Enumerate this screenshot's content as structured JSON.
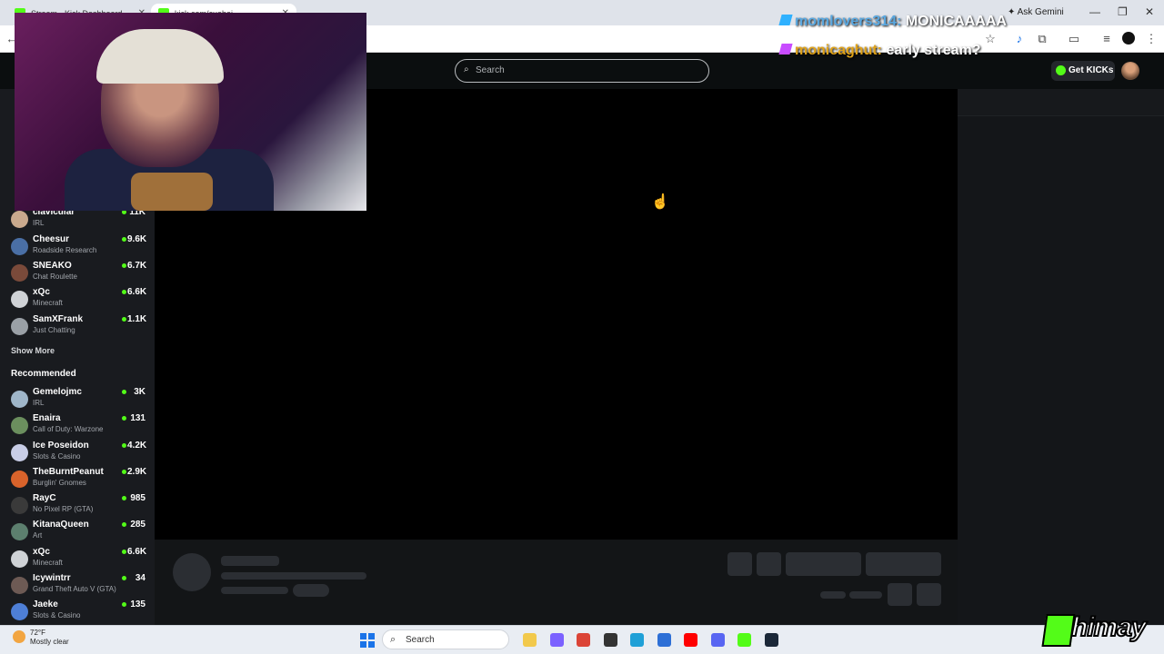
{
  "browser": {
    "tabs": [
      {
        "title": "Stream - Kick Dashboard"
      },
      {
        "title": "kick.com/cuebei"
      }
    ],
    "gemini_label": "Ask Gemini"
  },
  "kick": {
    "search_placeholder": "Search",
    "get_kicks_label": "Get KICKs"
  },
  "sidebar": {
    "following": [
      {
        "name": "clavicular",
        "category": "IRL",
        "viewers": "11K",
        "color": "#c9a98d"
      },
      {
        "name": "Cheesur",
        "category": "Roadside Research",
        "viewers": "9.6K",
        "color": "#4a6fa5"
      },
      {
        "name": "SNEAKO",
        "category": "Chat Roulette",
        "viewers": "6.7K",
        "color": "#7a4a3a"
      },
      {
        "name": "xQc",
        "category": "Minecraft",
        "viewers": "6.6K",
        "color": "#cfd2d6"
      },
      {
        "name": "SamXFrank",
        "category": "Just Chatting",
        "viewers": "1.1K",
        "color": "#9aa0a6"
      }
    ],
    "show_more": "Show More",
    "recommended_heading": "Recommended",
    "recommended": [
      {
        "name": "Gemelojmc",
        "category": "IRL",
        "viewers": "3K",
        "color": "#9fb6c9"
      },
      {
        "name": "Enaira",
        "category": "Call of Duty: Warzone",
        "viewers": "131",
        "color": "#6b8f5e"
      },
      {
        "name": "Ice Poseidon",
        "category": "Slots & Casino",
        "viewers": "4.2K",
        "color": "#c8cde6"
      },
      {
        "name": "TheBurntPeanut",
        "category": "Burglin' Gnomes",
        "viewers": "2.9K",
        "color": "#d9632b"
      },
      {
        "name": "RayC",
        "category": "No Pixel RP (GTA)",
        "viewers": "985",
        "color": "#3a3a3a"
      },
      {
        "name": "KitanaQueen",
        "category": "Art",
        "viewers": "285",
        "color": "#5c7f6e"
      },
      {
        "name": "xQc",
        "category": "Minecraft",
        "viewers": "6.6K",
        "color": "#cfd2d6"
      },
      {
        "name": "Icywintrr",
        "category": "Grand Theft Auto V (GTA)",
        "viewers": "34",
        "color": "#6d5a54"
      },
      {
        "name": "Jaeke",
        "category": "Slots & Casino",
        "viewers": "135",
        "color": "#4e7fd6"
      }
    ]
  },
  "overlay": {
    "chat": [
      {
        "user": "momlovers314:",
        "message": "MONICAAAAA",
        "user_color": "#5aa8e0",
        "icon_color": "#2fb1ff"
      },
      {
        "user": "monicaghut:",
        "message": "early stream?",
        "user_color": "#e0a31b",
        "icon_color": "#c84cff"
      }
    ],
    "logo_text": "himay"
  },
  "taskbar": {
    "temperature": "72°F",
    "condition": "Mostly clear",
    "search_label": "Search",
    "apps": [
      {
        "name": "file-explorer",
        "color": "#f2c94c"
      },
      {
        "name": "copilot",
        "color": "#7b61ff"
      },
      {
        "name": "chrome",
        "color": "#db4437"
      },
      {
        "name": "obs",
        "color": "#333333"
      },
      {
        "name": "edge",
        "color": "#1fa0d7"
      },
      {
        "name": "store",
        "color": "#2d6fd6"
      },
      {
        "name": "youtube",
        "color": "#ff0000"
      },
      {
        "name": "discord",
        "color": "#5865f2"
      },
      {
        "name": "kick",
        "color": "#53fc18"
      },
      {
        "name": "steam",
        "color": "#1b2838"
      }
    ]
  }
}
